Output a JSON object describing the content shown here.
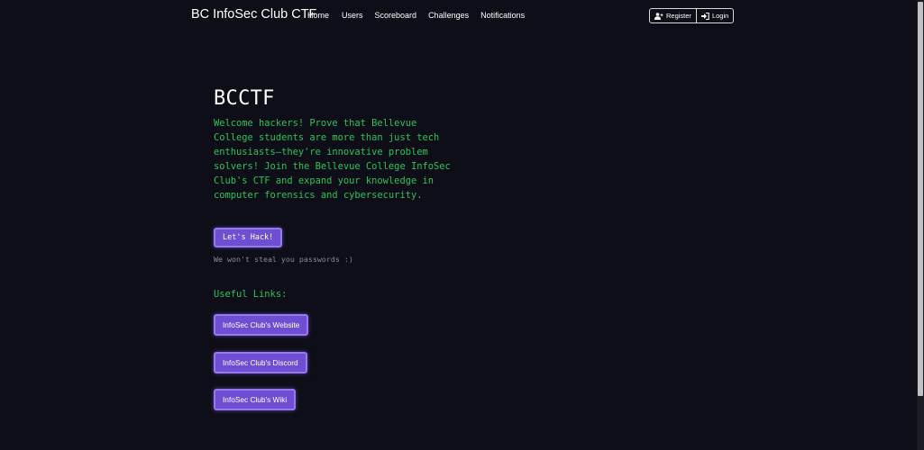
{
  "navbar": {
    "brand": "BC InfoSec Club CTF",
    "links": [
      "Home",
      "Users",
      "Scoreboard",
      "Challenges",
      "Notifications"
    ],
    "register_label": "Register",
    "login_label": "Login"
  },
  "hero": {
    "title": "BCCTF",
    "text": "Welcome hackers! Prove that Bellevue College students are more than just tech enthusiasts—they're innovative problem solvers! Join the Bellevue College InfoSec Club's CTF and expand your knowledge in computer forensics and cybersecurity.",
    "cta_label": "Let's Hack!",
    "note": "We won't steal you passwords :)"
  },
  "links": {
    "heading": "Useful Links:",
    "items": [
      "InfoSec Club's Website",
      "InfoSec Club's Discord",
      "InfoSec Club's Wiki"
    ]
  },
  "colors": {
    "background": "#0e0e18",
    "accent_green": "#2ec25a",
    "button_purple": "#6e4fd3",
    "button_border": "#9479f0"
  },
  "icons": {
    "register": "user-plus-icon",
    "login": "sign-in-icon"
  }
}
